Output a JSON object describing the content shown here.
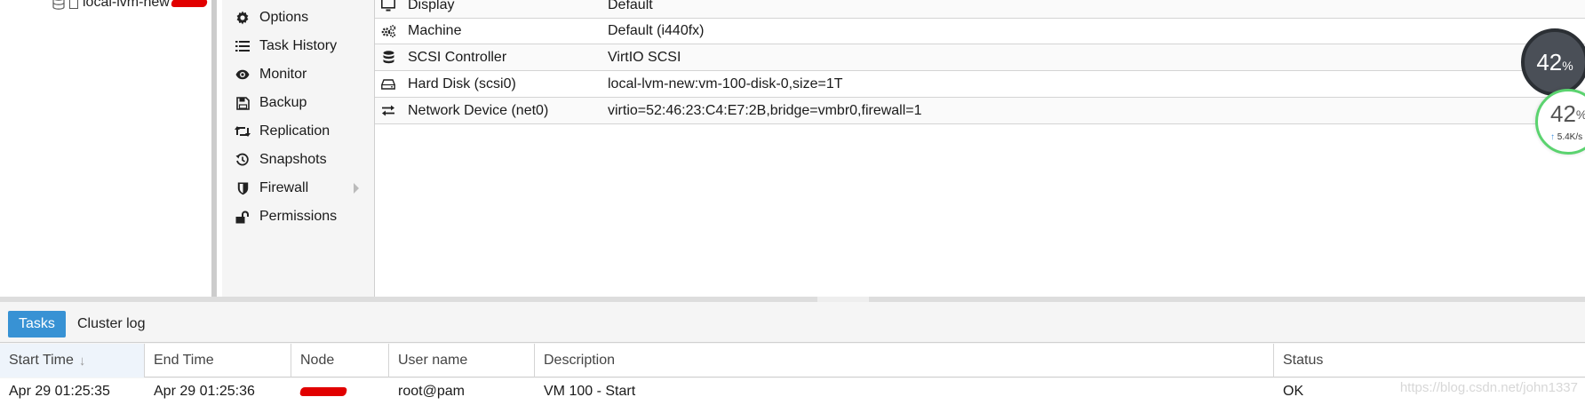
{
  "tree": {
    "storage_label": "local-lvm-new"
  },
  "vm_menu": [
    {
      "label": "Options",
      "icon": "gear-icon"
    },
    {
      "label": "Task History",
      "icon": "list-icon"
    },
    {
      "label": "Monitor",
      "icon": "eye-icon"
    },
    {
      "label": "Backup",
      "icon": "floppy-icon"
    },
    {
      "label": "Replication",
      "icon": "retweet-icon"
    },
    {
      "label": "Snapshots",
      "icon": "history-icon"
    },
    {
      "label": "Firewall",
      "icon": "shield-icon",
      "has_submenu": true
    },
    {
      "label": "Permissions",
      "icon": "unlock-icon"
    }
  ],
  "hardware": [
    {
      "name": "Display",
      "value": "Default",
      "icon": "monitor-icon"
    },
    {
      "name": "Machine",
      "value": "Default (i440fx)",
      "icon": "cogs-icon"
    },
    {
      "name": "SCSI Controller",
      "value": "VirtIO SCSI",
      "icon": "database-icon"
    },
    {
      "name": "Hard Disk (scsi0)",
      "value": "local-lvm-new:vm-100-disk-0,size=1T",
      "icon": "hdd-icon"
    },
    {
      "name": "Network Device (net0)",
      "value": "virtio=52:46:23:C4:E7:2B,bridge=vmbr0,firewall=1",
      "icon": "exchange-icon"
    }
  ],
  "bottom_tabs": {
    "tasks": "Tasks",
    "cluster_log": "Cluster log"
  },
  "tasks_table": {
    "columns": [
      "Start Time",
      "End Time",
      "Node",
      "User name",
      "Description",
      "Status"
    ],
    "sort_indicator": "↓",
    "rows": [
      {
        "start": "Apr 29 01:25:35",
        "end": "Apr 29 01:25:36",
        "node": "",
        "user": "root@pam",
        "description": "VM 100 - Start",
        "status": "OK"
      }
    ]
  },
  "watermark": "https://blog.csdn.net/john1337",
  "speed_widget": {
    "percent_value": "42",
    "percent_sign": "%",
    "upload_speed": "5.4K/s",
    "colors": {
      "dark_bg": "#4a4f57",
      "ring": "#5bd36f"
    }
  },
  "colors": {
    "accent": "#3892d4",
    "redaction": "#e10000"
  }
}
